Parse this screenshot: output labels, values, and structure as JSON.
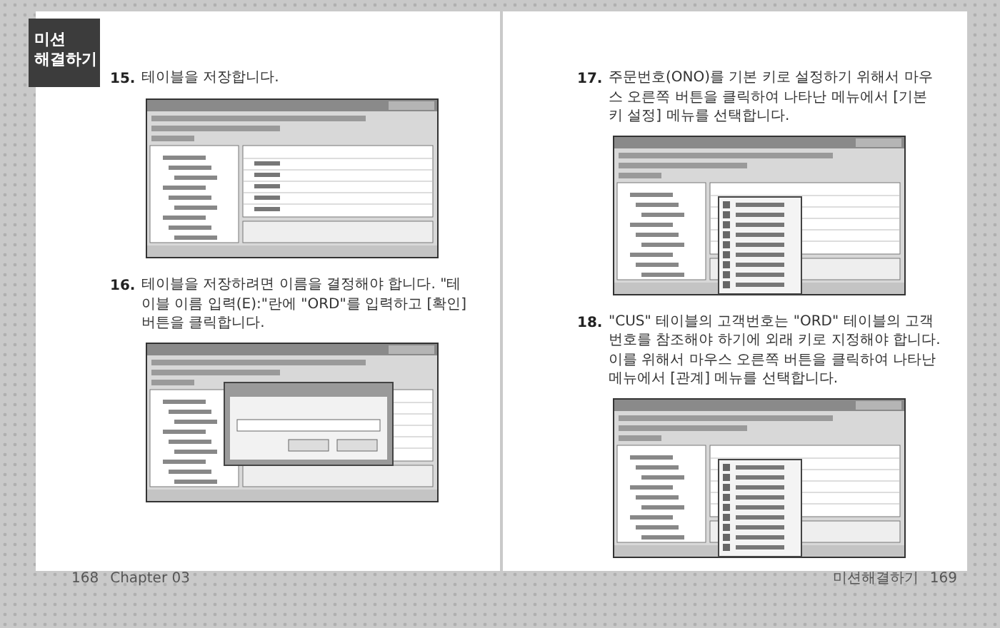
{
  "badge": {
    "line_1": "미션",
    "line_2": "해결하기"
  },
  "left_page": {
    "steps": [
      {
        "number": "15.",
        "text": "테이블을 저장합니다.",
        "screenshot": {
          "kind": "plain"
        }
      },
      {
        "number": "16.",
        "text": "테이블을 저장하려면 이름을 결정해야 합니다. \"테이블 이름 입력(E):\"란에 \"ORD\"를 입력하고 [확인] 버튼을 클릭합니다.",
        "screenshot": {
          "kind": "dialog"
        }
      }
    ],
    "footer": {
      "page_number": "168",
      "chapter": "Chapter 03"
    }
  },
  "right_page": {
    "steps": [
      {
        "number": "17.",
        "text": "주문번호(ONO)를 기본 키로 설정하기 위해서 마우스 오른쪽 버튼을 클릭하여 나타난 메뉴에서 [기본 키 설정] 메뉴를 선택합니다.",
        "screenshot": {
          "kind": "menu"
        }
      },
      {
        "number": "18.",
        "text": "\"CUS\" 테이블의 고객번호는 \"ORD\" 테이블의 고객번호를 참조해야 하기에 외래 키로 지정해야 합니다. 이를 위해서 마우스 오른쪽 버튼을 클릭하여 나타난 메뉴에서 [관계] 메뉴를 선택합니다.",
        "screenshot": {
          "kind": "menu"
        }
      }
    ],
    "footer": {
      "section": "미션해결하기",
      "page_number": "169"
    }
  }
}
